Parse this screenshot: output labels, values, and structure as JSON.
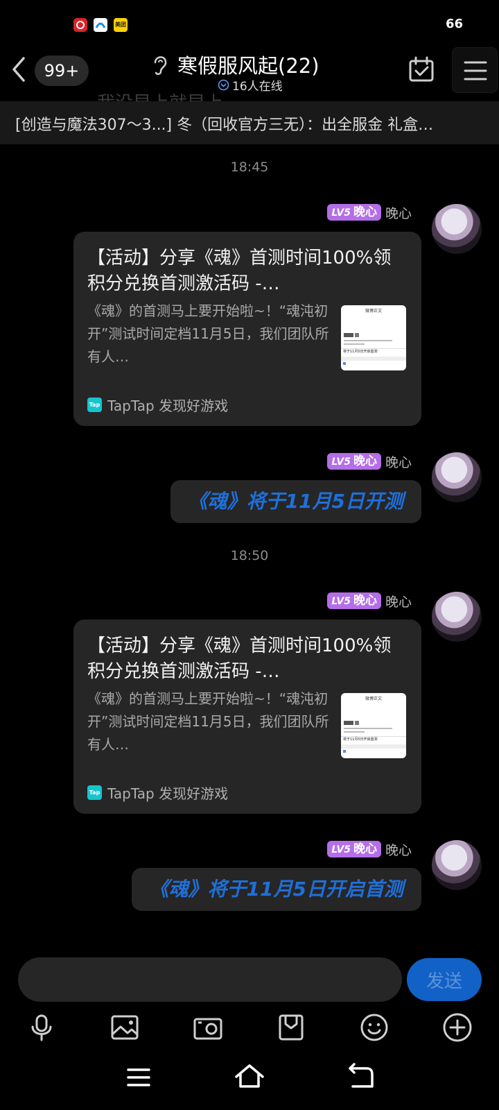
{
  "status_bar": {
    "battery": "66",
    "meituan_label": "美团"
  },
  "header": {
    "unread_badge": "99+",
    "title": "寒假服风起(22)",
    "online": "16人在线",
    "ghost_text": "我没早上就早上"
  },
  "announcement": {
    "text": "[创造与魔法307～3...] 冬（回收官方三无）：出全服金 礼盒…"
  },
  "messages": [
    {
      "time": "18:45",
      "level": "LV5",
      "badge_name": "晚心",
      "sender": "晚心",
      "card": {
        "title": "【活动】分享《魂》首测时间100%领积分兑换首测激活码 -…",
        "description": "《魂》的首测马上要开始啦~！“魂沌初开”测试时间定档11月5日，我们团队所有人…",
        "thumb_header": "微博正文",
        "thumb_caption": "将于11月5日开启首测",
        "source_icon": "Tap",
        "source": "TapTap 发现好游戏"
      }
    },
    {
      "level": "LV5",
      "badge_name": "晚心",
      "sender": "晚心",
      "text": "《魂》将于11月5日开测"
    },
    {
      "time": "18:50",
      "level": "LV5",
      "badge_name": "晚心",
      "sender": "晚心",
      "card": {
        "title": "【活动】分享《魂》首测时间100%领积分兑换首测激活码 -…",
        "description": "《魂》的首测马上要开始啦~！“魂沌初开”测试时间定档11月5日，我们团队所有人…",
        "thumb_header": "微博正文",
        "thumb_caption": "将于11月5日开启首测",
        "source_icon": "Tap",
        "source": "TapTap 发现好游戏"
      }
    },
    {
      "level": "LV5",
      "badge_name": "晚心",
      "sender": "晚心",
      "text": "《魂》将于11月5日开启首测"
    }
  ],
  "input": {
    "value": "",
    "send_label": "发送"
  },
  "icons": {
    "toolbar": [
      "microphone-icon",
      "image-icon",
      "camera-icon",
      "file-icon",
      "emoji-icon",
      "plus-icon"
    ],
    "nav": [
      "menu-icon",
      "home-icon",
      "back-icon"
    ]
  },
  "colors": {
    "level_badge": "#b46ee8",
    "link_text": "#1f6fd9",
    "send_button": "#1261c7",
    "taptap": "#15c5ce"
  }
}
